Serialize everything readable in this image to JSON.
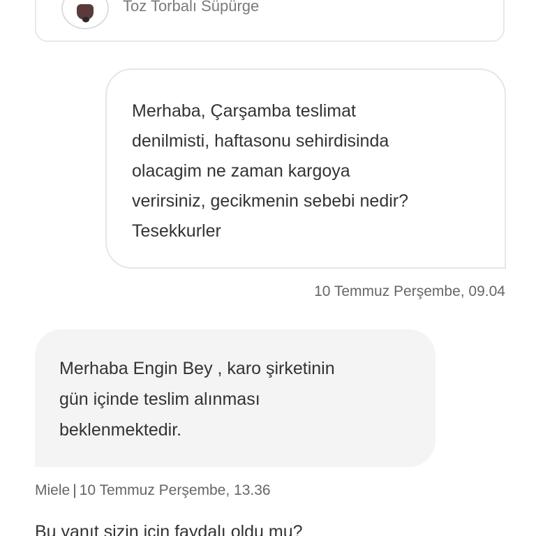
{
  "product": {
    "name": "Toz Torbalı Süpürge",
    "image_icon": "vacuum-cleaner-icon"
  },
  "messages": [
    {
      "direction": "sent",
      "text": "Merhaba, Çarşamba teslimat\ndenilmisti, haftasonu sehirdisinda\nolacagim ne zaman kargoya\nverirsiniz, gecikmenin sebebi nedir?\nTesekkurler",
      "timestamp": "10 Temmuz Perşembe, 09.04"
    },
    {
      "direction": "received",
      "sender": "Miele",
      "separator": "|",
      "text": "Merhaba Engin Bey , karo şirketinin\ngün içinde teslim alınması\nbeklenmektedir.",
      "timestamp": "10 Temmuz Perşembe, 13.36"
    }
  ],
  "feedback": {
    "question": "Bu yanıt sizin için faydalı oldu mu?"
  },
  "colors": {
    "received_bubble": "#f4f4f4",
    "sent_bubble_border": "#e6e6e6",
    "text": "#333333",
    "meta_text": "#666666"
  }
}
